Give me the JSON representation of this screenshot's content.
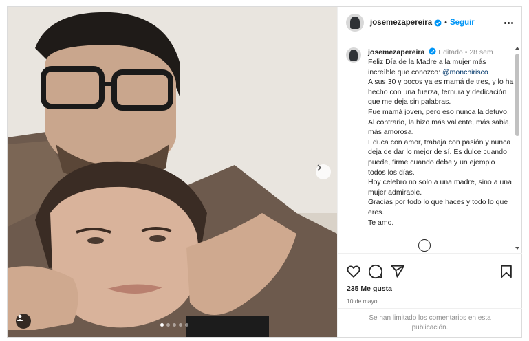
{
  "post": {
    "username": "josemezapereira",
    "follow_label": "Seguir",
    "separator": "•"
  },
  "caption": {
    "username": "josemezapereira",
    "edited_label": "Editado",
    "dot": "•",
    "time": "28 sem",
    "line1": "Feliz Día de la Madre a la mujer más increíble que conozco: ",
    "mention": "@monchirisco",
    "paragraphs": [
      "A sus 30 y pocos ya es mamá de tres, y lo ha hecho con una fuerza, ternura y dedicación que me deja sin palabras.",
      "Fue mamá joven, pero eso nunca la detuvo. Al contrario, la hizo más valiente, más sabia, más amorosa.",
      "Educa con amor, trabaja con pasión y nunca deja de dar lo mejor de sí. Es dulce cuando puede, firme cuando debe y un ejemplo todos los días.",
      "Hoy celebro no solo a una madre, sino a una mujer admirable.",
      "Gracias por todo lo que haces y todo lo que eres.",
      "Te amo."
    ]
  },
  "stats": {
    "likes": "235 Me gusta",
    "date": "10 de mayo"
  },
  "comments_limited": "Se han limitado los comentarios en esta publicación.",
  "carousel": {
    "total": 5,
    "active_index": 0
  },
  "icons": {
    "verified": "verified-badge-icon",
    "like": "heart-icon",
    "comment": "comment-icon",
    "share": "share-icon",
    "save": "bookmark-icon",
    "next": "chevron-right-icon",
    "tag": "user-tag-icon",
    "more": "more-options-icon",
    "add_comment": "plus-circle-icon"
  },
  "colors": {
    "link": "#0095f6",
    "mention": "#00376b",
    "verified": "#0095f6"
  }
}
